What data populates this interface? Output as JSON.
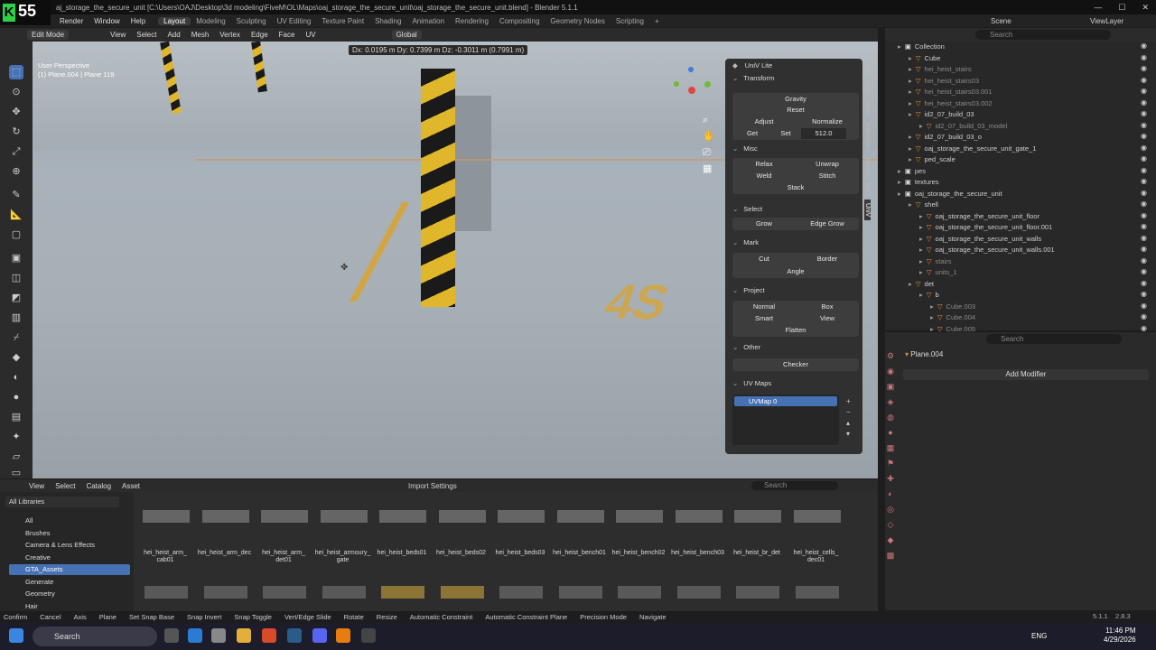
{
  "app": {
    "logo_letter": "K",
    "logo_num": "55",
    "title": "aj_storage_the_secure_unit [C:\\Users\\OAJ\\Desktop\\3d modeling\\FiveM\\OL\\Maps\\oaj_storage_the_secure_unit\\oaj_storage_the_secure_unit.blend] - Blender 5.1.1",
    "win": [
      "—",
      "☐",
      "✕"
    ]
  },
  "menu": {
    "items": [
      "Render",
      "Window",
      "Help"
    ],
    "workspaces": [
      "Layout",
      "Modeling",
      "Sculpting",
      "UV Editing",
      "Texture Paint",
      "Shading",
      "Animation",
      "Rendering",
      "Compositing",
      "Geometry Nodes",
      "Scripting",
      "+"
    ],
    "scene": "Scene",
    "viewlayer": "ViewLayer"
  },
  "vpheader": {
    "mode": "Edit Mode",
    "menus": [
      "View",
      "Select",
      "Add",
      "Mesh",
      "Vertex",
      "Edge",
      "Face",
      "UV"
    ],
    "transform": "Global",
    "dx": "Dx: 0.0195 m  Dy: 0.7399 m  Dz: -0.3011 m (0.7991 m)"
  },
  "viewport": {
    "line1": "User Perspective",
    "line2": "(1) Plane.004 | Plane 119",
    "painted": "4S"
  },
  "npanel": {
    "title": "UniV Lite",
    "transform": "Transform",
    "gravity": "Gravity",
    "reset": "Reset",
    "adjust": "Adjust",
    "normalize": "Normalize",
    "get": "Get",
    "set": "Set",
    "set_val": "512.0",
    "misc": "Misc",
    "relax": "Relax",
    "unwrap": "Unwrap",
    "weld": "Weld",
    "stitch": "Stitch",
    "stack": "Stack",
    "select": "Select",
    "grow": "Grow",
    "edge_grow": "Edge Grow",
    "mark": "Mark",
    "cut": "Cut",
    "border": "Border",
    "angle": "Angle",
    "project": "Project",
    "normal": "Normal",
    "box": "Box",
    "smart": "Smart",
    "view": "View",
    "flatten": "Flatten",
    "other": "Other",
    "checker": "Checker",
    "uvmaps": "UV Maps",
    "uvmap0": "UVMap 0"
  },
  "sidetabs": [
    "Item",
    "Tool",
    "View",
    "Animation",
    "Sollumz Tools",
    "UniV"
  ],
  "outliner": {
    "search": "Search",
    "items": [
      {
        "l": "Collection",
        "d": 0,
        "dim": false
      },
      {
        "l": "Cube",
        "d": 1,
        "dim": false
      },
      {
        "l": "hei_heist_stairs",
        "d": 1,
        "dim": true
      },
      {
        "l": "hei_heist_stairs03",
        "d": 1,
        "dim": true
      },
      {
        "l": "hei_heist_stairs03.001",
        "d": 1,
        "dim": true
      },
      {
        "l": "hei_heist_stairs03.002",
        "d": 1,
        "dim": true
      },
      {
        "l": "id2_07_build_03",
        "d": 1,
        "dim": false
      },
      {
        "l": "id2_07_build_03_model",
        "d": 2,
        "dim": true
      },
      {
        "l": "id2_07_build_03_o",
        "d": 1,
        "dim": false
      },
      {
        "l": "oaj_storage_the_secure_unit_gate_1",
        "d": 1,
        "dim": false
      },
      {
        "l": "ped_scale",
        "d": 1,
        "dim": false
      },
      {
        "l": "pes",
        "d": 0,
        "dim": false
      },
      {
        "l": "textures",
        "d": 0,
        "dim": false
      },
      {
        "l": "oaj_storage_the_secure_unit",
        "d": 0,
        "dim": false
      },
      {
        "l": "shell",
        "d": 1,
        "dim": false
      },
      {
        "l": "oaj_storage_the_secure_unit_floor",
        "d": 2,
        "dim": false
      },
      {
        "l": "oaj_storage_the_secure_unit_floor.001",
        "d": 2,
        "dim": false
      },
      {
        "l": "oaj_storage_the_secure_unit_walls",
        "d": 2,
        "dim": false
      },
      {
        "l": "oaj_storage_the_secure_unit_walls.001",
        "d": 2,
        "dim": false
      },
      {
        "l": "stairs",
        "d": 2,
        "dim": true
      },
      {
        "l": "units_1",
        "d": 2,
        "dim": true
      },
      {
        "l": "det",
        "d": 1,
        "dim": false
      },
      {
        "l": "b",
        "d": 2,
        "dim": false
      },
      {
        "l": "Cube.003",
        "d": 3,
        "dim": true
      },
      {
        "l": "Cube.004",
        "d": 3,
        "dim": true
      },
      {
        "l": "Cube.005",
        "d": 3,
        "dim": true
      }
    ]
  },
  "props": {
    "search": "Search",
    "object": "Plane.004",
    "add_modifier": "Add Modifier"
  },
  "abheader": {
    "menus": [
      "View",
      "Select",
      "Catalog",
      "Asset"
    ],
    "import": "Import Settings",
    "search": "Search"
  },
  "abside": {
    "library": "All Libraries",
    "items": [
      "All",
      "Brushes",
      "Camera & Lens Effects",
      "Creative",
      "GTA_Assets",
      "Generate",
      "Geometry",
      "Hair"
    ],
    "selected": 4
  },
  "assets": [
    [
      "hei_heist_arm_",
      "cab01"
    ],
    [
      "hei_heist_arm_dec",
      ""
    ],
    [
      "hei_heist_arm_",
      "det01"
    ],
    [
      "hei_heist_armoury_",
      "gate"
    ],
    [
      "hei_heist_beds01",
      ""
    ],
    [
      "hei_heist_beds02",
      ""
    ],
    [
      "hei_heist_beds03",
      ""
    ],
    [
      "hei_heist_bench01",
      ""
    ],
    [
      "hei_heist_bench02",
      ""
    ],
    [
      "hei_heist_bench03",
      ""
    ],
    [
      "hei_heist_br_det",
      ""
    ],
    [
      "hei_heist_cells_",
      "dec01"
    ]
  ],
  "status": [
    "Confirm",
    "Cancel",
    "Axis",
    "Plane",
    "Set Snap Base",
    "Snap Invert",
    "Snap Toggle",
    "Vert/Edge Slide",
    "Rotate",
    "Resize",
    "Automatic Constraint",
    "Automatic Constraint Plane",
    "Precision Mode",
    "Navigate"
  ],
  "status_right": {
    "version": "5.1.1",
    "mem": "2.8.3"
  },
  "taskbar": {
    "search": "Search",
    "lang": "ENG",
    "time": "11:46 PM",
    "date": "4/29/2026"
  },
  "colors": {
    "accent": "#4672b4",
    "hazard": "#e0b62a"
  }
}
